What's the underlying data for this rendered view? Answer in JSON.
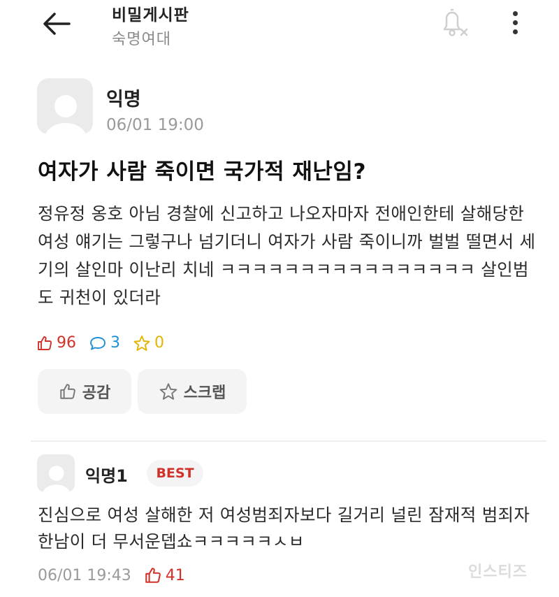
{
  "header": {
    "board_title": "비밀게시판",
    "board_subtitle": "숙명여대",
    "icons": [
      "back-arrow-icon",
      "bell-off-icon",
      "more-vertical-icon"
    ]
  },
  "post": {
    "author": "익명",
    "time": "06/01 19:00",
    "title": "여자가 사람 죽이면 국가적 재난임?",
    "body": "정유정 옹호 아님 경찰에 신고하고 나오자마자 전애인한테 살해당한 여성 얘기는 그렇구나 넘기더니 여자가 사람 죽이니까 벌벌 떨면서 세기의 살인마 이난리 치네 ㅋㅋㅋㅋㅋㅋㅋㅋㅋㅋㅋㅋㅋㅋㅋㅋ 살인범도 귀천이 있더라",
    "likes": "96",
    "comments": "3",
    "scraps": "0",
    "like_button": "공감",
    "scrap_button": "스크랩"
  },
  "comment": {
    "author": "익명1",
    "badge": "BEST",
    "body": "진심으로 여성 살해한 저 여성범죄자보다 길거리 널린 잠재적 범죄자 한남이 더 무서운뎁쇼ㅋㅋㅋㅋㅋㅅㅂ",
    "time": "06/01 19:43",
    "likes": "41"
  },
  "watermark": "인스티즈",
  "colors": {
    "like": "#d2312a",
    "comment": "#1e8fd8",
    "scrap": "#e5b400",
    "muted": "#9a9a9a"
  }
}
